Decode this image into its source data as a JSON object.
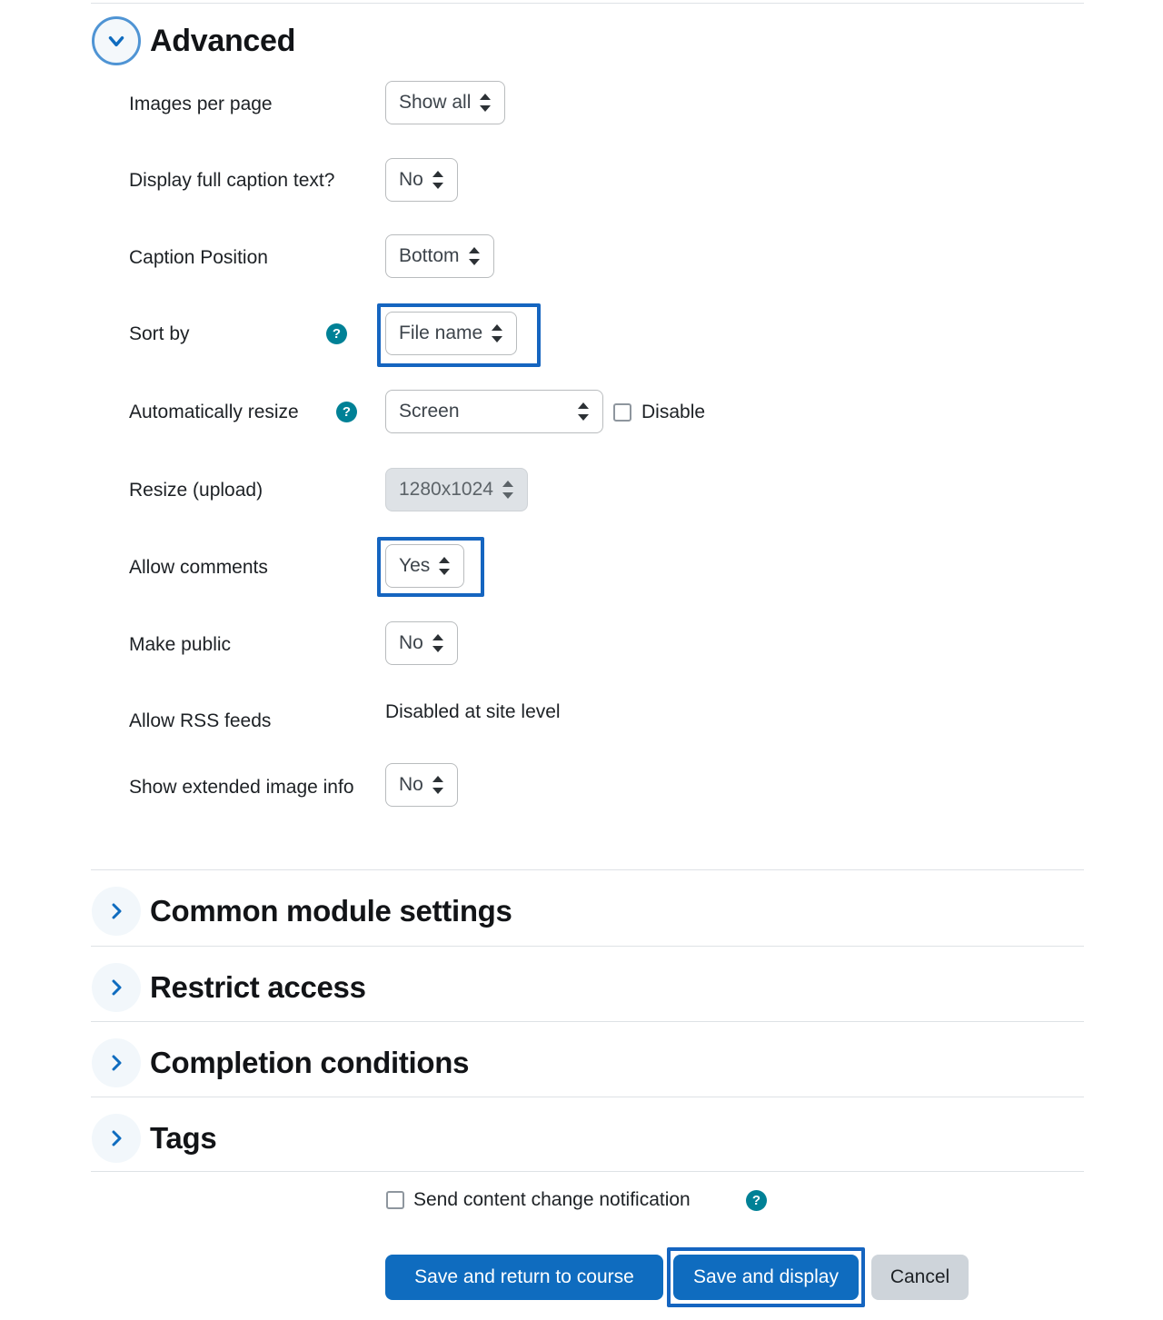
{
  "sections": {
    "advanced": {
      "title": "Advanced",
      "expanded": true,
      "chevron_icon": "chevron-down-icon"
    },
    "collapsed": [
      {
        "title": "Common module settings",
        "chevron_icon": "chevron-right-icon"
      },
      {
        "title": "Restrict access",
        "chevron_icon": "chevron-right-icon"
      },
      {
        "title": "Completion conditions",
        "chevron_icon": "chevron-right-icon"
      },
      {
        "title": "Tags",
        "chevron_icon": "chevron-right-icon"
      }
    ]
  },
  "fields": {
    "images_per_page": {
      "label": "Images per page",
      "value": "Show all"
    },
    "display_full_caption": {
      "label": "Display full caption text?",
      "value": "No"
    },
    "caption_position": {
      "label": "Caption Position",
      "value": "Bottom"
    },
    "sort_by": {
      "label": "Sort by",
      "value": "File name",
      "help_icon": "help-circle-icon",
      "highlighted": true
    },
    "automatically_resize": {
      "label": "Automatically resize",
      "value": "Screen",
      "help_icon": "help-circle-icon",
      "disable_checkbox_label": "Disable",
      "disable_checked": false
    },
    "resize_upload": {
      "label": "Resize (upload)",
      "value": "1280x1024",
      "disabled": true
    },
    "allow_comments": {
      "label": "Allow comments",
      "value": "Yes",
      "highlighted": true
    },
    "make_public": {
      "label": "Make public",
      "value": "No"
    },
    "allow_rss_feeds": {
      "label": "Allow RSS feeds",
      "value": "Disabled at site level"
    },
    "show_extended_image_info": {
      "label": "Show extended image info",
      "value": "No"
    }
  },
  "footer": {
    "notify": {
      "label": "Send content change notification",
      "checked": false,
      "help_icon": "help-circle-icon"
    },
    "buttons": {
      "save_return": "Save and return to course",
      "save_display": "Save and display",
      "cancel": "Cancel"
    },
    "save_display_highlighted": true
  },
  "colors": {
    "primary": "#0f6cbf",
    "secondary": "#ced4da",
    "help_teal": "#008196",
    "highlight": "#1565c0",
    "chevron_blue": "#0f6cbf",
    "divider": "#dee2e6"
  },
  "help_glyph": "?"
}
